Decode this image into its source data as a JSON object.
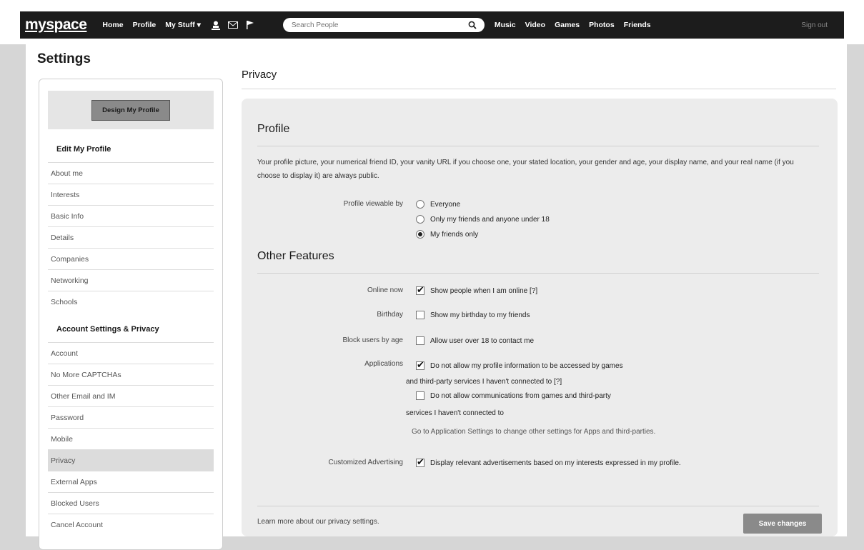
{
  "nav": {
    "logo_prefix": "my",
    "logo_suffix": "space",
    "links": [
      "Home",
      "Profile",
      "My Stuff ▾"
    ],
    "icons": [
      "person-icon",
      "mail-icon",
      "flag-icon"
    ],
    "search_placeholder": "Search People",
    "right_links": [
      "Music",
      "Video",
      "Games",
      "Photos",
      "Friends"
    ],
    "signout": "Sign out"
  },
  "page_title": "Settings",
  "sidebar": {
    "design_button": "Design My Profile",
    "section1": "Edit My Profile",
    "items1": [
      "About me",
      "Interests",
      "Basic Info",
      "Details",
      "Companies",
      "Networking",
      "Schools"
    ],
    "section2": "Account Settings & Privacy",
    "items2": [
      "Account",
      "No More CAPTCHAs",
      "Other Email and IM",
      "Password",
      "Mobile",
      "Privacy",
      "External Apps",
      "Blocked Users",
      "Cancel Account"
    ],
    "active_item": "Privacy"
  },
  "privacy": {
    "title": "Privacy",
    "profile_heading": "Profile",
    "profile_desc": "Your profile picture, your numerical friend ID, your vanity URL if you choose one, your stated location, your gender and age, your display name, and your real name (if you choose to display it) are always public.",
    "viewable_label": "Profile viewable by",
    "viewable_options": [
      "Everyone",
      "Only my friends and anyone under 18",
      "My friends only"
    ],
    "viewable_selected": "My friends only",
    "other_heading": "Other Features",
    "online_label": "Online now",
    "online_text": "Show people when I am online [?]",
    "birthday_label": "Birthday",
    "birthday_text": "Show my birthday to my friends",
    "block_label": "Block users by age",
    "block_text": "Allow user over 18 to contact me",
    "apps_label": "Applications",
    "apps_opt1_line1": "Do not allow my profile information to be accessed by games",
    "apps_opt1_line2": "and third-party services I haven't connected to [?]",
    "apps_opt2_line1": "Do not allow communications from games and third-party",
    "apps_opt2_line2": "services I haven't connected to",
    "apps_note": "Go to Application Settings to change other settings for Apps and third-parties.",
    "ads_label": "Customized Advertising",
    "ads_text": "Display relevant advertisements based on my interests expressed in my profile.",
    "learn_more": "Learn more about our privacy settings.",
    "save": "Save changes"
  }
}
